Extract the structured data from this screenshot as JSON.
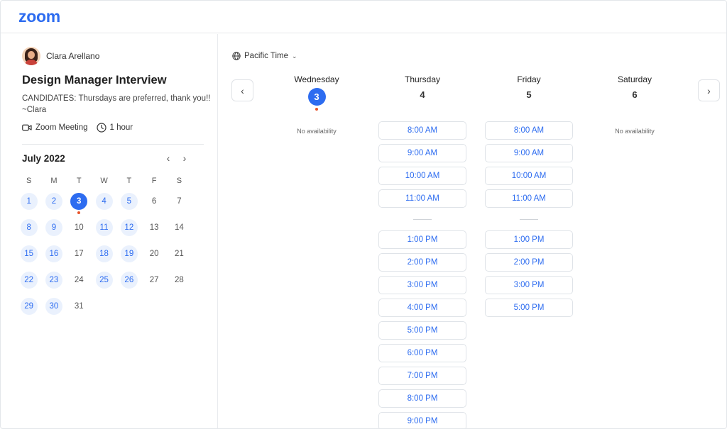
{
  "header": {
    "logo": "zoom"
  },
  "event": {
    "host_name": "Clara Arellano",
    "title": "Design Manager Interview",
    "description": "CANDIDATES: Thursdays are preferred, thank you!! ~Clara",
    "meeting_type": "Zoom Meeting",
    "duration": "1 hour"
  },
  "calendar": {
    "month_label": "July 2022",
    "weekdays": [
      "S",
      "M",
      "T",
      "W",
      "T",
      "F",
      "S"
    ],
    "selected_day": 3,
    "available_days": [
      1,
      2,
      3,
      4,
      5,
      8,
      9,
      11,
      12,
      15,
      16,
      18,
      19,
      22,
      23,
      25,
      26,
      29,
      30
    ],
    "weeks": [
      [
        1,
        2,
        3,
        4,
        5,
        6,
        7
      ],
      [
        8,
        9,
        10,
        11,
        12,
        13,
        14
      ],
      [
        15,
        16,
        17,
        18,
        19,
        20,
        21
      ],
      [
        22,
        23,
        24,
        25,
        26,
        27,
        28
      ],
      [
        29,
        30,
        31
      ]
    ]
  },
  "schedule": {
    "timezone": "Pacific Time",
    "no_availability_text": "No availability",
    "days": [
      {
        "name": "Wednesday",
        "num": "3",
        "selected": true,
        "slots": []
      },
      {
        "name": "Thursday",
        "num": "4",
        "selected": false,
        "slots_morning": [
          "8:00 AM",
          "9:00 AM",
          "10:00 AM",
          "11:00 AM"
        ],
        "slots_afternoon": [
          "1:00 PM",
          "2:00 PM",
          "3:00 PM",
          "4:00 PM",
          "5:00 PM",
          "6:00 PM",
          "7:00 PM",
          "8:00 PM",
          "9:00 PM"
        ]
      },
      {
        "name": "Friday",
        "num": "5",
        "selected": false,
        "slots_morning": [
          "8:00 AM",
          "9:00 AM",
          "10:00 AM",
          "11:00 AM"
        ],
        "slots_afternoon": [
          "1:00 PM",
          "2:00 PM",
          "3:00 PM",
          "5:00 PM"
        ]
      },
      {
        "name": "Saturday",
        "num": "6",
        "selected": false,
        "slots": []
      }
    ]
  },
  "colors": {
    "accent": "#2d6cf0",
    "today_dot": "#e8542a",
    "available_bg": "#eaf1fd"
  }
}
